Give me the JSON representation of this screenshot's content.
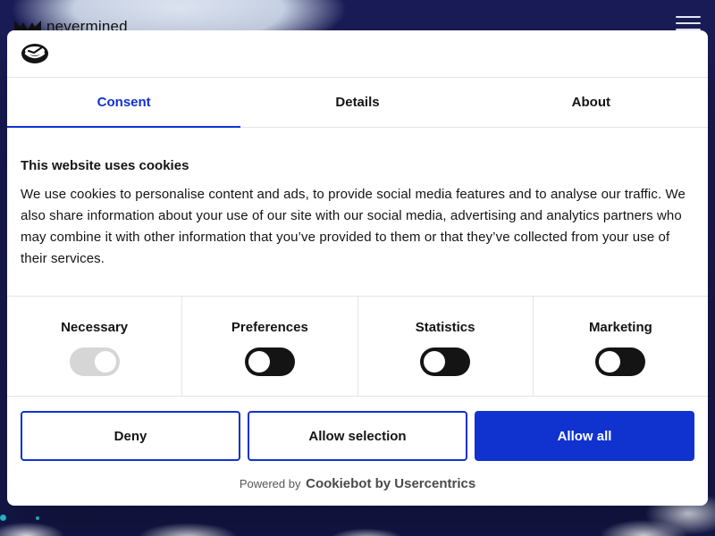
{
  "site": {
    "brand_name": "nevermined"
  },
  "dialog": {
    "tabs": [
      {
        "label": "Consent",
        "active": true
      },
      {
        "label": "Details",
        "active": false
      },
      {
        "label": "About",
        "active": false
      }
    ],
    "heading": "This website uses cookies",
    "description": "We use cookies to personalise content and ads, to provide social media features and to analyse our traffic. We also share information about your use of our site with our social media, advertising and analytics partners who may combine it with other information that you’ve provided to them or that they’ve collected from your use of their services.",
    "categories": [
      {
        "label": "Necessary",
        "checked": true,
        "disabled": true
      },
      {
        "label": "Preferences",
        "checked": false,
        "disabled": false
      },
      {
        "label": "Statistics",
        "checked": false,
        "disabled": false
      },
      {
        "label": "Marketing",
        "checked": false,
        "disabled": false
      }
    ],
    "buttons": {
      "deny": "Deny",
      "allow_selection": "Allow selection",
      "allow_all": "Allow all"
    },
    "powered_by_prefix": "Powered by",
    "powered_by_brand": "Cookiebot by Usercentrics"
  },
  "colors": {
    "accent": "#1032cf",
    "toggle_off": "#141414",
    "toggle_disabled": "#d6d6d6"
  }
}
